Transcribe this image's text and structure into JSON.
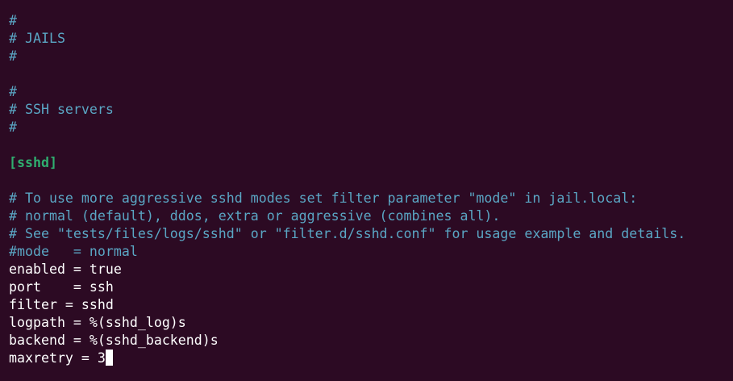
{
  "editor": {
    "lines": [
      {
        "text": "#",
        "kind": "comment"
      },
      {
        "text": "# JAILS",
        "kind": "comment"
      },
      {
        "text": "#",
        "kind": "comment"
      },
      {
        "text": "",
        "kind": "blank"
      },
      {
        "text": "#",
        "kind": "comment"
      },
      {
        "text": "# SSH servers",
        "kind": "comment"
      },
      {
        "text": "#",
        "kind": "comment"
      },
      {
        "text": "",
        "kind": "blank"
      },
      {
        "text": "[sshd]",
        "kind": "section"
      },
      {
        "text": "",
        "kind": "blank"
      },
      {
        "text": "# To use more aggressive sshd modes set filter parameter \"mode\" in jail.local:",
        "kind": "comment"
      },
      {
        "text": "# normal (default), ddos, extra or aggressive (combines all).",
        "kind": "comment"
      },
      {
        "text": "# See \"tests/files/logs/sshd\" or \"filter.d/sshd.conf\" for usage example and details.",
        "kind": "comment"
      },
      {
        "text": "#mode   = normal",
        "kind": "comment"
      },
      {
        "text": "enabled = true",
        "kind": "plain"
      },
      {
        "text": "port    = ssh",
        "kind": "plain"
      },
      {
        "text": "filter = sshd",
        "kind": "plain"
      },
      {
        "text": "logpath = %(sshd_log)s",
        "kind": "plain"
      },
      {
        "text": "backend = %(sshd_backend)s",
        "kind": "plain"
      },
      {
        "text": "maxretry = 3",
        "kind": "plain",
        "cursor": true
      }
    ],
    "colors": {
      "background": "#2c0a23",
      "comment": "#5aa6c4",
      "section": "#2fae6f",
      "text": "#ffffff"
    }
  }
}
